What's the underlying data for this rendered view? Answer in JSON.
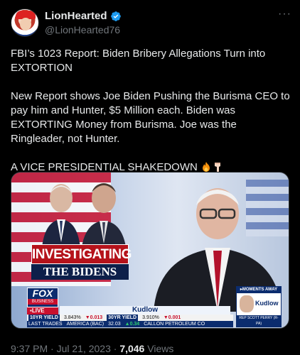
{
  "author": {
    "display_name": "LionHearted",
    "handle": "@LionHearted76",
    "verified_icon": "verified-badge-icon",
    "verified_color": "#1d9bf0"
  },
  "more_label": "···",
  "tweet": {
    "paragraph1": "FBI’s 1023 Report: Biden Bribery Allegations Turn into EXTORTION",
    "paragraph2": "New Report shows Joe Biden Pushing the Burisma CEO to pay him and Hunter, $5 Million each. Biden was EXTORTING Money from Burisma. Joe was the Ringleader, not Hunter.",
    "paragraph3": "A VICE PRESIDENTIAL SHAKEDOWN",
    "emojis": [
      "fire-emoji",
      "pointing-down-emoji"
    ]
  },
  "media": {
    "banner_investigating": "INVESTIGATING",
    "banner_bidens": "THE BIDENS",
    "fox_logo_line1": "FOX",
    "fox_logo_line2": "BUSINESS",
    "live_label": "LIVE",
    "show_name": "Kudlow",
    "ticker_top": {
      "label1": "10YR YIELD",
      "value1": "3.843%",
      "change1": "▼0.013",
      "label2": "30YR YIELD",
      "value2": "3.910%",
      "change2": "▼0.001"
    },
    "ticker_bottom": {
      "label": "LAST TRADES",
      "item1": "AMERICA (BAC)",
      "price1": "32.03",
      "change1": "▲0.34",
      "item2": "CALLON PETROLEUM CO"
    },
    "moments_away": "▸MOMENTS AWAY",
    "moments_show": "Kudlow",
    "moments_guest": "REP SCOTT PERRY (R-PA)"
  },
  "meta": {
    "time": "9:37 PM · Jul 21, 2023 · ",
    "views_count": "7,046",
    "views_label": " Views"
  }
}
